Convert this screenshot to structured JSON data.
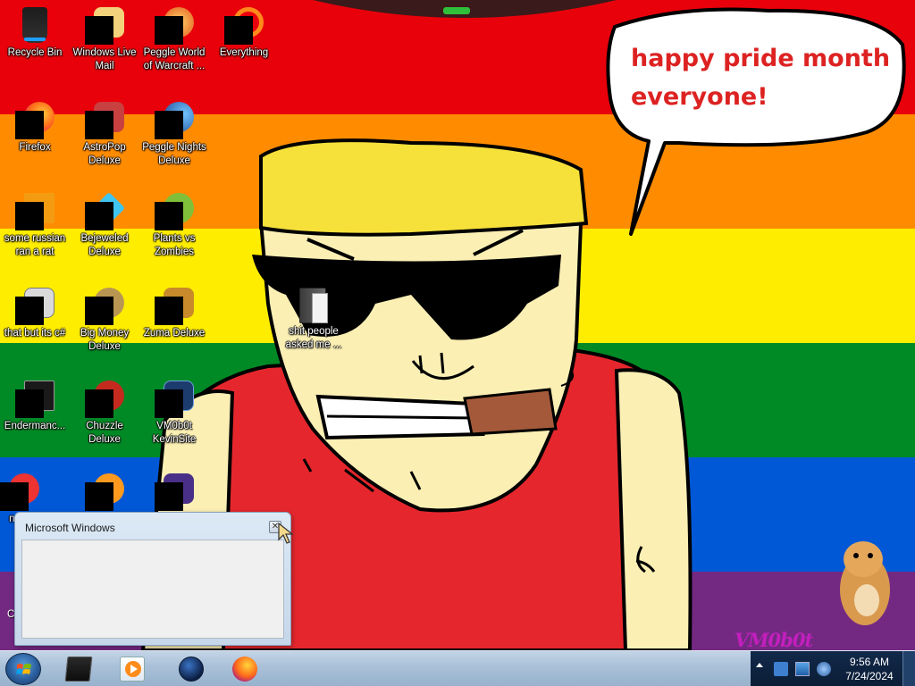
{
  "colors": {
    "stripes": [
      "#e8000b",
      "#ff8c00",
      "#ffed00",
      "#008a26",
      "#0058d6",
      "#732982"
    ],
    "speech_text": "#dd2222",
    "skin": "#fbefb4",
    "shirt": "#e5272d",
    "hair": "#f6e03a"
  },
  "wallpaper": {
    "speech_bubble": {
      "line1": "happy pride month",
      "line2": "everyone!"
    },
    "signature": "VM0b0t"
  },
  "desktop_icons": [
    {
      "label": "Recycle Bin",
      "icon": "recycle-bin-icon"
    },
    {
      "label": "Windows Live\nMail",
      "icon": "mail-icon"
    },
    {
      "label": "Peggle World\nof Warcraft ...",
      "icon": "peggle-wow-icon"
    },
    {
      "label": "Everything",
      "icon": "search-icon"
    },
    {
      "label": "Firefox",
      "icon": "firefox-icon"
    },
    {
      "label": "AstroPop\nDeluxe",
      "icon": "astropop-icon"
    },
    {
      "label": "Peggle Nights\nDeluxe",
      "icon": "peggle-nights-icon"
    },
    {
      "label": "some russian\nran a rat",
      "icon": "russian-rat-icon"
    },
    {
      "label": "Bejeweled\nDeluxe",
      "icon": "bejeweled-icon"
    },
    {
      "label": "Plants vs\nZombies",
      "icon": "plants-vs-zombies-icon"
    },
    {
      "label": "that but its c#",
      "icon": "shortcut-icon"
    },
    {
      "label": "Big Money\nDeluxe",
      "icon": "money-bag-icon"
    },
    {
      "label": "Zuma Deluxe",
      "icon": "zuma-icon"
    },
    {
      "label": "Endermanc...",
      "icon": "terminal-icon"
    },
    {
      "label": "Chuzzle\nDeluxe",
      "icon": "chuzzle-icon"
    },
    {
      "label": "VM0b0t\nKevinSite",
      "icon": "video-icon"
    },
    {
      "label": "n\nre",
      "icon": "app-icon"
    },
    {
      "label": "",
      "icon": "fish-icon"
    },
    {
      "label": "",
      "icon": "document-icon"
    },
    {
      "label": "shit people\nasked me ...",
      "icon": "folder-icon"
    },
    {
      "label": "C",
      "icon": "app-icon"
    }
  ],
  "dialog": {
    "title": "Microsoft Windows",
    "close_glyph": "✕"
  },
  "taskbar": {
    "pinned": [
      {
        "name": "terminal-icon"
      },
      {
        "name": "media-player-icon"
      },
      {
        "name": "globe-icon"
      },
      {
        "name": "firefox-icon"
      }
    ],
    "clock": {
      "time": "9:56 AM",
      "date": "7/24/2024"
    }
  }
}
